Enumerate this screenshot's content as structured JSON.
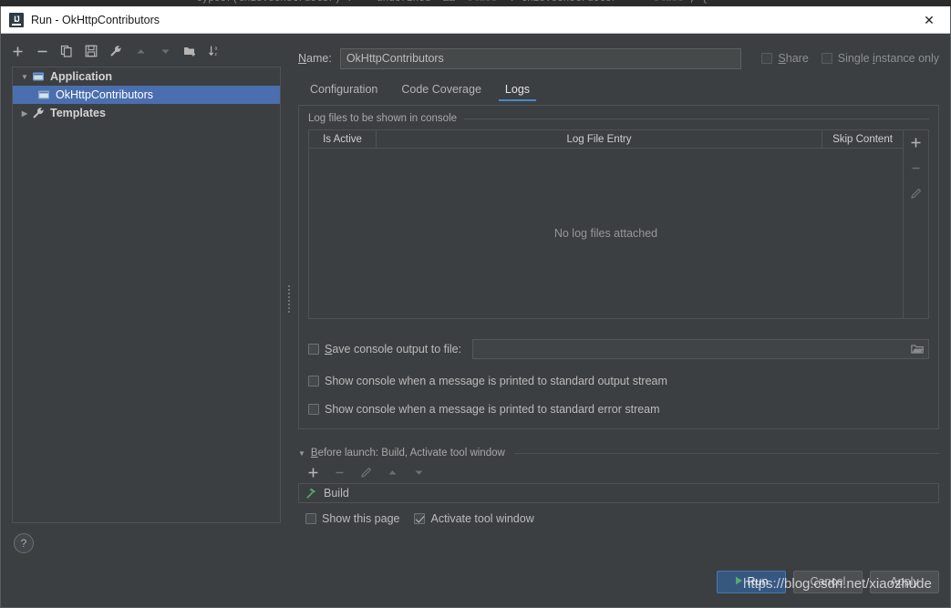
{
  "background_strip": {
    "code_prefix": "typeof(this.constructor) !== 'undefined' && ",
    "code_str1": "'class'",
    "code_mid": " : this.constructor === ",
    "code_str2": "'class'",
    "code_suffix": ", {"
  },
  "titlebar": {
    "app_icon": "intellij-idea-icon",
    "title": "Run - OkHttpContributors",
    "close_icon": "✕"
  },
  "sidebar": {
    "toolbar": [
      {
        "name": "add-configuration-button",
        "icon": "plus-icon",
        "enabled": true
      },
      {
        "name": "remove-configuration-button",
        "icon": "minus-icon",
        "enabled": true
      },
      {
        "name": "copy-configuration-button",
        "icon": "copy-icon",
        "enabled": true
      },
      {
        "name": "save-configuration-button",
        "icon": "save-icon",
        "enabled": true
      },
      {
        "name": "edit-templates-button",
        "icon": "wrench-icon",
        "enabled": true
      },
      {
        "name": "move-up-button",
        "icon": "arrow-up-icon",
        "enabled": false
      },
      {
        "name": "move-down-button",
        "icon": "arrow-down-icon",
        "enabled": false
      },
      {
        "name": "create-folder-button",
        "icon": "folder-add-icon",
        "enabled": true
      },
      {
        "name": "sort-configurations-button",
        "icon": "sort-alpha-icon",
        "enabled": true
      }
    ],
    "tree": [
      {
        "label": "Application",
        "icon": "application-icon",
        "type": "group",
        "expanded": true,
        "twisty": "▼",
        "selected": false
      },
      {
        "label": "OkHttpContributors",
        "icon": "application-icon",
        "type": "child",
        "selected": true
      },
      {
        "label": "Templates",
        "icon": "wrench-icon",
        "type": "group",
        "expanded": false,
        "twisty": "▶",
        "selected": false
      }
    ],
    "help_button": "?"
  },
  "config": {
    "name_label_pre": "",
    "name_label_mnemonic": "N",
    "name_label_post": "ame:",
    "name_value": "OkHttpContributors",
    "name_placeholder": "",
    "share": {
      "label_pre": "",
      "mnemonic": "S",
      "label_post": "hare",
      "checked": false,
      "enabled": false
    },
    "single_instance": {
      "label_pre": "Single ",
      "mnemonic": "i",
      "label_post": "nstance only",
      "checked": false,
      "enabled": false
    },
    "tabs": [
      {
        "label": "Configuration",
        "active": false
      },
      {
        "label": "Code Coverage",
        "active": false
      },
      {
        "label": "Logs",
        "active": true
      }
    ]
  },
  "logs": {
    "group_title": "Log files to be shown in console",
    "columns": [
      "Is Active",
      "Log File Entry",
      "Skip Content"
    ],
    "rows": [],
    "empty_text": "No log files attached",
    "side_buttons": [
      {
        "name": "add-log-file-button",
        "icon": "plus-icon",
        "enabled": true
      },
      {
        "name": "remove-log-file-button",
        "icon": "minus-icon",
        "enabled": false
      },
      {
        "name": "edit-log-file-button",
        "icon": "pencil-icon",
        "enabled": false
      }
    ],
    "save_console": {
      "label_pre": "",
      "mnemonic": "S",
      "label_post": "ave console output to file:",
      "checked": false,
      "path_value": "",
      "browse_icon": "folder-icon"
    },
    "show_on_stdout": {
      "label": "Show console when a message is printed to standard output stream",
      "checked": false
    },
    "show_on_stderr": {
      "label": "Show console when a message is printed to standard error stream",
      "checked": false
    }
  },
  "before_launch": {
    "caret": "▼",
    "title_pre": "",
    "title_mnemonic": "B",
    "title_post": "efore launch: Build, Activate tool window",
    "toolbar": [
      {
        "name": "add-before-launch-task-button",
        "icon": "plus-icon",
        "enabled": true
      },
      {
        "name": "remove-before-launch-task-button",
        "icon": "minus-icon",
        "enabled": false
      },
      {
        "name": "edit-before-launch-task-button",
        "icon": "pencil-icon",
        "enabled": false
      },
      {
        "name": "move-task-up-button",
        "icon": "arrow-up-icon",
        "enabled": false
      },
      {
        "name": "move-task-down-button",
        "icon": "arrow-down-icon",
        "enabled": false
      }
    ],
    "tasks": [
      {
        "label": "Build",
        "icon": "build-hammer-icon"
      }
    ],
    "show_this_page": {
      "label": "Show this page",
      "checked": false
    },
    "activate_tool_window": {
      "label": "Activate tool window",
      "checked": true
    }
  },
  "footer": {
    "run_button": "Run",
    "run_icon": "play-icon",
    "cancel_button": "Cancel",
    "apply_button": "Apply"
  },
  "watermark": {
    "text": "https://blog.csdn.net/xiaozhude"
  },
  "colors": {
    "panel_bg": "#3c3f41",
    "selection_blue": "#4b6eaf",
    "tab_underline": "#4a88c7",
    "primary_button": "#365880",
    "build_icon_green": "#59a869",
    "run_icon_green": "#59a869",
    "titlebar_bg": "#ffffff"
  }
}
